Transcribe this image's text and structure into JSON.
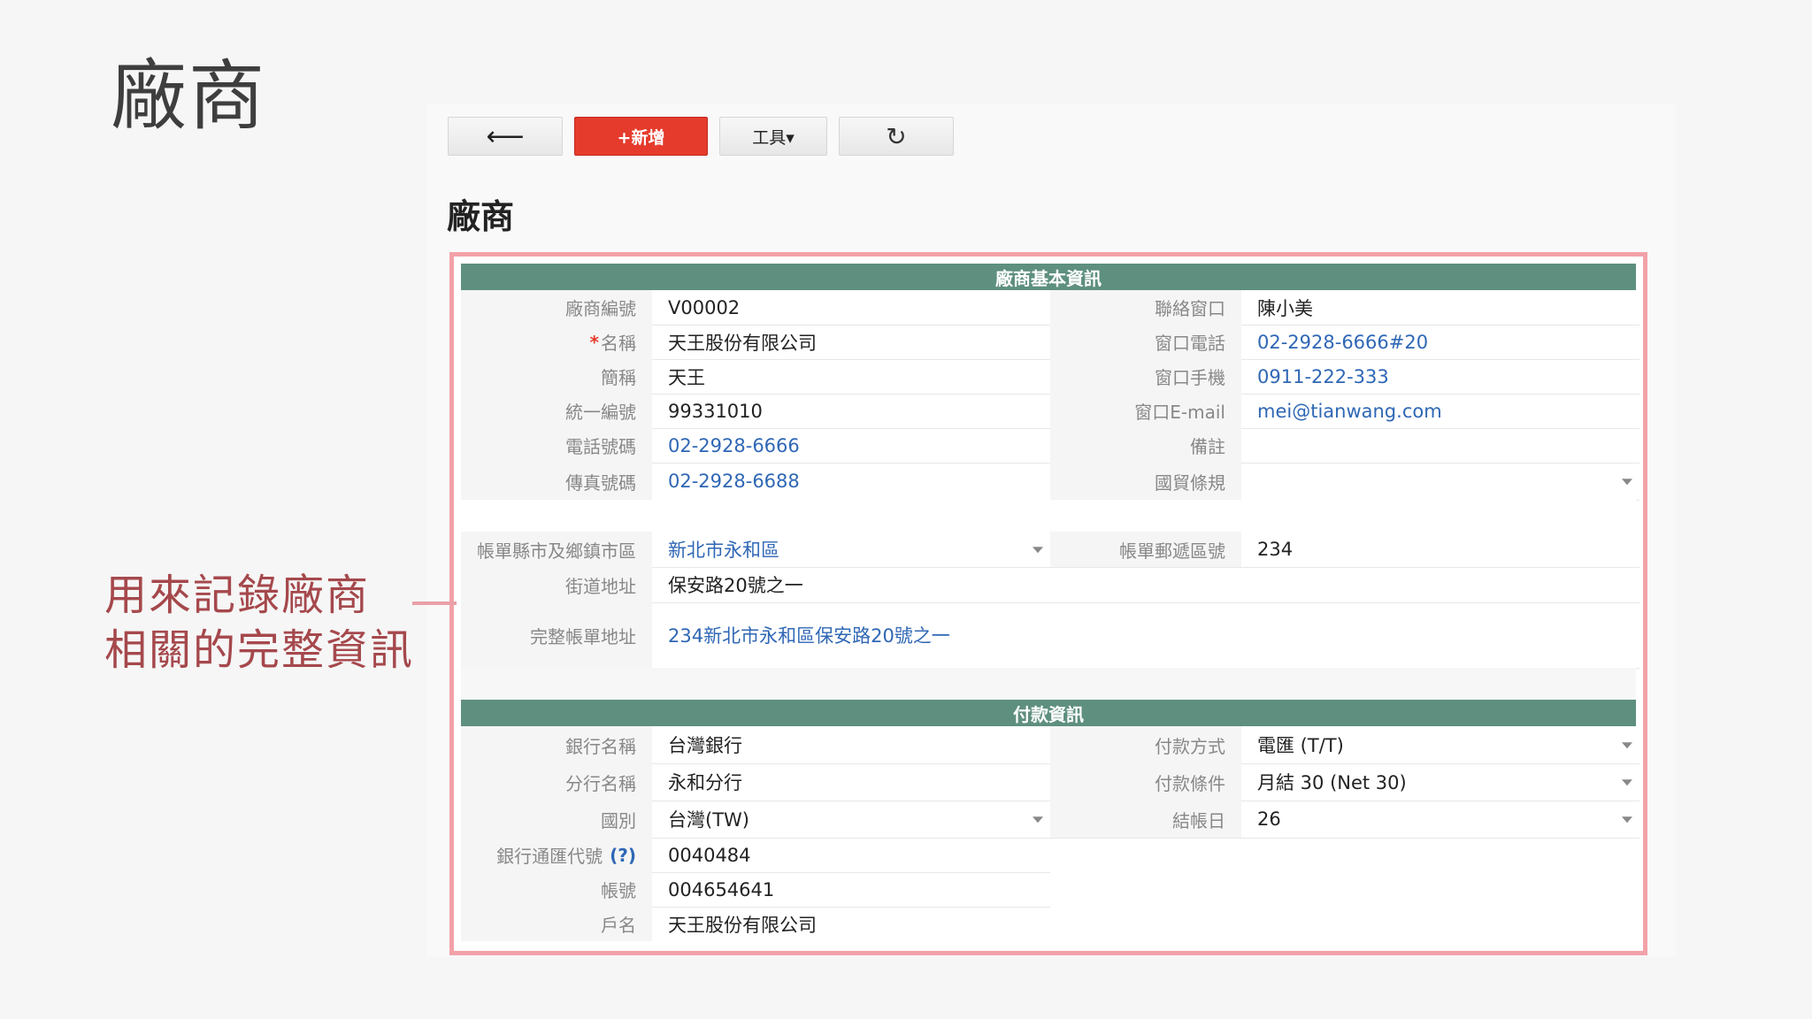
{
  "slide": {
    "title": "廠商",
    "callout_line1": "用來記錄廠商",
    "callout_line2": "相關的完整資訊"
  },
  "toolbar": {
    "back_label": "⟵",
    "new_label": "+新增",
    "tools_label": "工具▾",
    "refresh_label": "↻"
  },
  "form": {
    "title": "廠商",
    "sections": {
      "basic_title": "廠商基本資訊",
      "payment_title": "付款資訊"
    },
    "basic": {
      "vendor_no": {
        "label": "廠商編號",
        "value": "V00002"
      },
      "name": {
        "required_mark": "*",
        "label": "名稱",
        "value": "天王股份有限公司"
      },
      "short_name": {
        "label": "簡稱",
        "value": "天王"
      },
      "tax_id": {
        "label": "統一編號",
        "value": "99331010"
      },
      "phone": {
        "label": "電話號碼",
        "value": "02-2928-6666"
      },
      "fax": {
        "label": "傳真號碼",
        "value": "02-2928-6688"
      },
      "contact": {
        "label": "聯絡窗口",
        "value": "陳小美"
      },
      "contact_phone": {
        "label": "窗口電話",
        "value": "02-2928-6666#20"
      },
      "contact_mobile": {
        "label": "窗口手機",
        "value": "0911-222-333"
      },
      "contact_email": {
        "label": "窗口E-mail",
        "value": "mei@tianwang.com"
      },
      "note": {
        "label": "備註",
        "value": ""
      },
      "incoterms": {
        "label": "國貿條規",
        "value": ""
      },
      "billing_city": {
        "label": "帳單縣市及鄉鎮市區",
        "value": "新北市永和區"
      },
      "billing_zip": {
        "label": "帳單郵遞區號",
        "value": "234"
      },
      "street": {
        "label": "街道地址",
        "value": "保安路20號之一"
      },
      "full_address": {
        "label": "完整帳單地址",
        "value": "234新北市永和區保安路20號之一"
      }
    },
    "payment": {
      "bank": {
        "label": "銀行名稱",
        "value": "台灣銀行"
      },
      "branch": {
        "label": "分行名稱",
        "value": "永和分行"
      },
      "country": {
        "label": "國別",
        "value": "台灣(TW)"
      },
      "swift": {
        "label": "銀行通匯代號",
        "help": "(?)",
        "value": "0040484"
      },
      "account": {
        "label": "帳號",
        "value": "004654641"
      },
      "account_name": {
        "label": "戶名",
        "value": "天王股份有限公司"
      },
      "method": {
        "label": "付款方式",
        "value": "電匯 (T/T)"
      },
      "terms": {
        "label": "付款條件",
        "value": "月結 30 (Net 30)"
      },
      "closing_day": {
        "label": "結帳日",
        "value": "26"
      }
    }
  }
}
